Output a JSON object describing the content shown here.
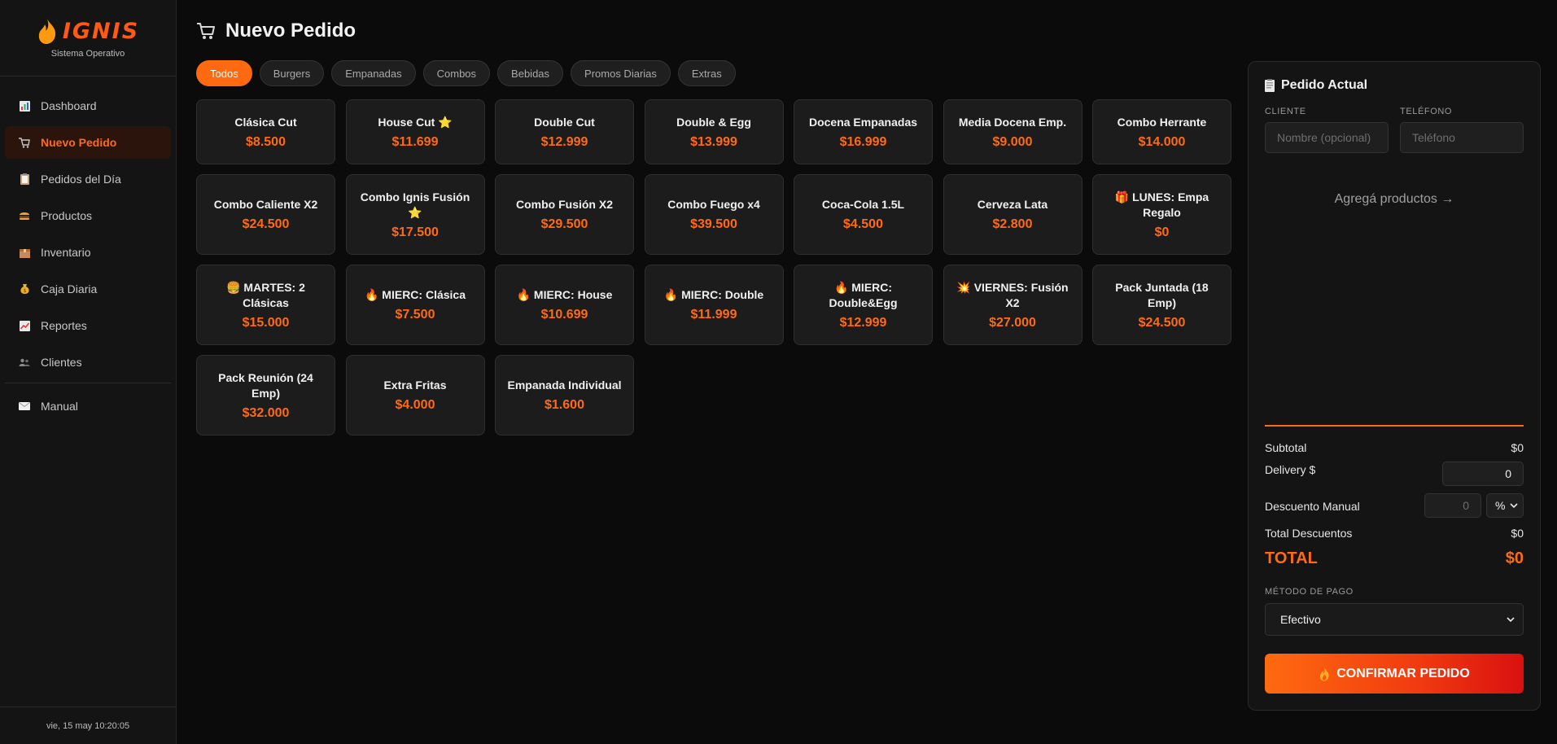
{
  "brand": {
    "name": "IGNIS",
    "subtitle": "Sistema Operativo",
    "accent": "#ff5a14"
  },
  "sidebar": {
    "items": [
      {
        "label": "Dashboard",
        "icon": "bar-chart-icon"
      },
      {
        "label": "Nuevo Pedido",
        "icon": "cart-icon",
        "active": true
      },
      {
        "label": "Pedidos del Día",
        "icon": "clipboard-icon"
      },
      {
        "label": "Productos",
        "icon": "burger-icon"
      },
      {
        "label": "Inventario",
        "icon": "box-icon"
      },
      {
        "label": "Caja Diaria",
        "icon": "money-bag-icon"
      },
      {
        "label": "Reportes",
        "icon": "trend-chart-icon"
      },
      {
        "label": "Clientes",
        "icon": "people-icon"
      },
      {
        "label": "Manual",
        "icon": "mail-icon"
      }
    ],
    "datetime": "vie, 15 may 10:20:05"
  },
  "main": {
    "title": "Nuevo Pedido",
    "tabs": [
      "Todos",
      "Burgers",
      "Empanadas",
      "Combos",
      "Bebidas",
      "Promos Diarias",
      "Extras"
    ],
    "active_tab": "Todos",
    "products": [
      {
        "name": "Clásica Cut",
        "price": "$8.500"
      },
      {
        "name": "House Cut ⭐",
        "price": "$11.699"
      },
      {
        "name": "Double Cut",
        "price": "$12.999"
      },
      {
        "name": "Double & Egg",
        "price": "$13.999"
      },
      {
        "name": "Docena Empanadas",
        "price": "$16.999"
      },
      {
        "name": "Media Docena Emp.",
        "price": "$9.000"
      },
      {
        "name": "Combo Herrante",
        "price": "$14.000"
      },
      {
        "name": "Combo Caliente X2",
        "price": "$24.500"
      },
      {
        "name": "Combo Ignis Fusión ⭐",
        "price": "$17.500"
      },
      {
        "name": "Combo Fusión X2",
        "price": "$29.500"
      },
      {
        "name": "Combo Fuego x4",
        "price": "$39.500"
      },
      {
        "name": "Coca-Cola 1.5L",
        "price": "$4.500"
      },
      {
        "name": "Cerveza Lata",
        "price": "$2.800"
      },
      {
        "name": "🎁 LUNES: Empa Regalo",
        "price": "$0"
      },
      {
        "name": "🍔 MARTES: 2 Clásicas",
        "price": "$15.000"
      },
      {
        "name": "🔥 MIERC: Clásica",
        "price": "$7.500"
      },
      {
        "name": "🔥 MIERC: House",
        "price": "$10.699"
      },
      {
        "name": "🔥 MIERC: Double",
        "price": "$11.999"
      },
      {
        "name": "🔥 MIERC: Double&Egg",
        "price": "$12.999"
      },
      {
        "name": "💥 VIERNES: Fusión X2",
        "price": "$27.000"
      },
      {
        "name": "Pack Juntada (18 Emp)",
        "price": "$24.500"
      },
      {
        "name": "Pack Reunión (24 Emp)",
        "price": "$32.000"
      },
      {
        "name": "Extra Fritas",
        "price": "$4.000"
      },
      {
        "name": "Empanada Individual",
        "price": "$1.600"
      }
    ]
  },
  "order": {
    "title": "Pedido Actual",
    "client_label": "CLIENTE",
    "client_placeholder": "Nombre (opcional)",
    "phone_label": "TELÉFONO",
    "phone_placeholder": "Teléfono",
    "empty_message": "Agregá productos →",
    "subtotal_label": "Subtotal",
    "subtotal_value": "$0",
    "delivery_label": "Delivery $",
    "delivery_value": "0",
    "discount_label": "Descuento Manual",
    "discount_value": "0",
    "discount_type": "%",
    "total_discounts_label": "Total Descuentos",
    "total_discounts_value": "$0",
    "total_label": "TOTAL",
    "total_value": "$0",
    "payment_label": "MÉTODO DE PAGO",
    "payment_value": "Efectivo",
    "confirm_label": "CONFIRMAR PEDIDO"
  }
}
